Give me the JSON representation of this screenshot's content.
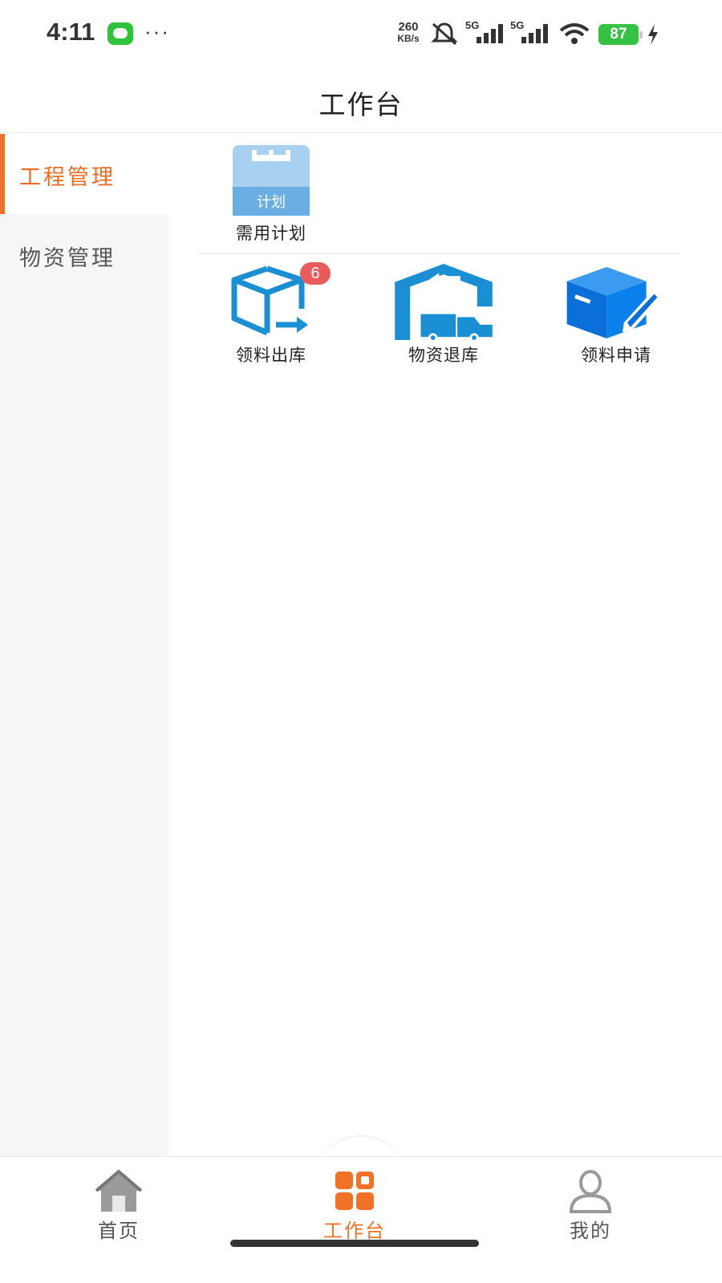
{
  "status_bar": {
    "time": "4:11",
    "dots": "···",
    "net_speed_value": "260",
    "net_speed_unit": "KB/s",
    "sim1": "5G",
    "sim2": "5G",
    "battery": "87"
  },
  "header": {
    "title": "工作台"
  },
  "sidebar": {
    "items": [
      {
        "label": "工程管理",
        "active": true
      },
      {
        "label": "物资管理",
        "active": false
      }
    ]
  },
  "content": {
    "plan_tile": {
      "label": "需用计划",
      "icon_text": "计划",
      "icon": "calendar-plan-icon"
    },
    "tiles": [
      {
        "label": "领料出库",
        "icon": "box-out-icon",
        "badge": "6"
      },
      {
        "label": "物资退库",
        "icon": "warehouse-return-icon"
      },
      {
        "label": "领料申请",
        "icon": "box-edit-icon"
      }
    ]
  },
  "tabbar": {
    "items": [
      {
        "label": "首页",
        "icon": "home-icon",
        "active": false
      },
      {
        "label": "工作台",
        "icon": "grid-icon",
        "active": true
      },
      {
        "label": "我的",
        "icon": "user-icon",
        "active": false
      }
    ]
  },
  "colors": {
    "accent": "#f07227",
    "badge": "#ea5b5b",
    "icon_blue": "#1b8fd3",
    "icon_dark_blue": "#0a6fd8"
  }
}
